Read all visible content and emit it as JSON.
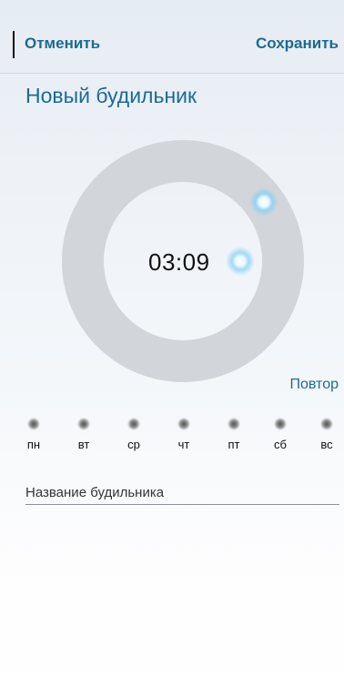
{
  "header": {
    "cancel_label": "Отменить",
    "save_label": "Сохранить"
  },
  "page": {
    "title": "Новый будильник"
  },
  "dial": {
    "time": "03:09"
  },
  "repeat": {
    "label": "Повтор",
    "days": [
      {
        "label": "пн"
      },
      {
        "label": "вт"
      },
      {
        "label": "ср"
      },
      {
        "label": "чт"
      },
      {
        "label": "пт"
      },
      {
        "label": "сб"
      },
      {
        "label": "вс"
      }
    ]
  },
  "name_field": {
    "placeholder": "Название будильника"
  },
  "colors": {
    "accent": "#1b6a95",
    "ring": "#d2d6db"
  }
}
